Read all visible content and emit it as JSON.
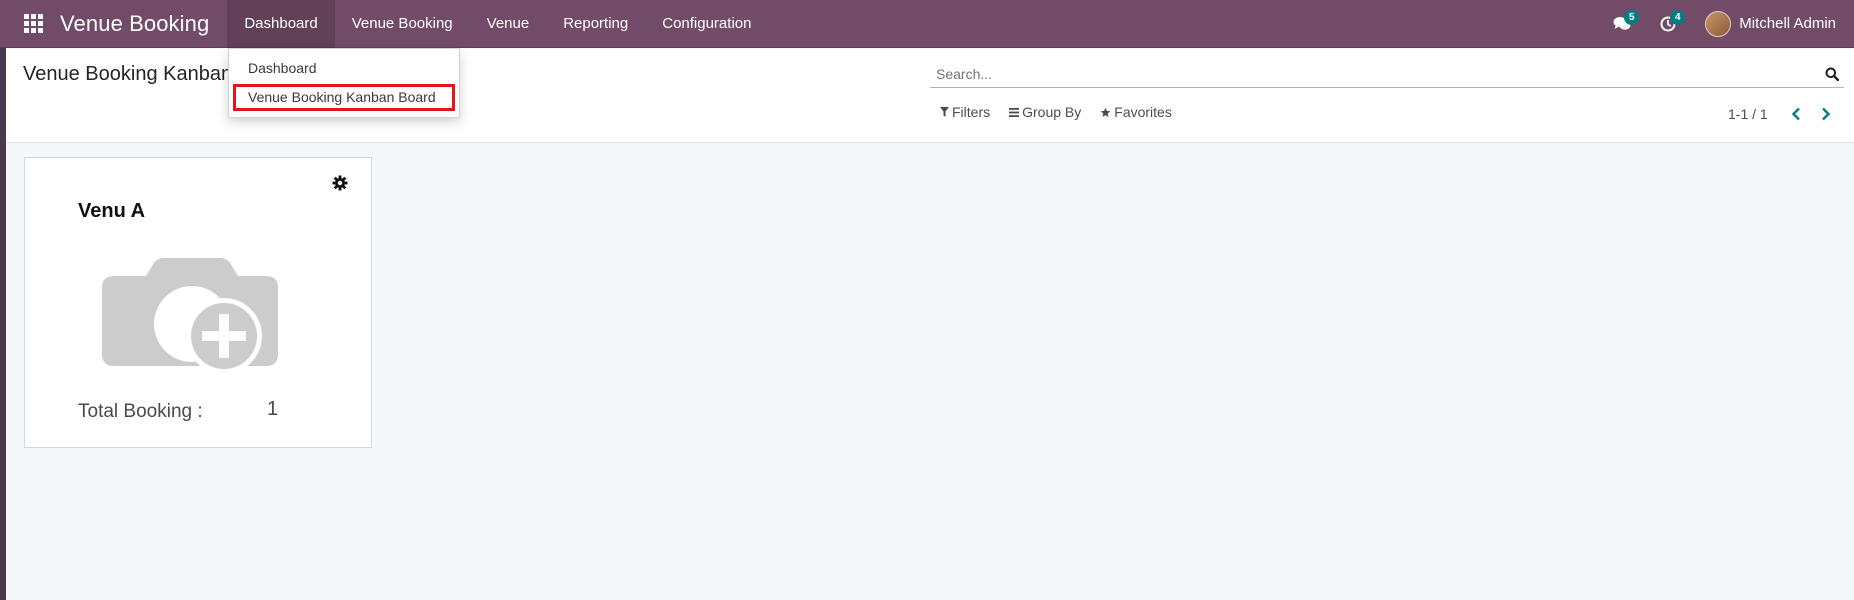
{
  "navbar": {
    "brand": "Venue Booking",
    "menu": [
      {
        "label": "Dashboard"
      },
      {
        "label": "Venue Booking"
      },
      {
        "label": "Venue"
      },
      {
        "label": "Reporting"
      },
      {
        "label": "Configuration"
      }
    ],
    "messages_badge": "5",
    "activities_badge": "4",
    "user_name": "Mitchell Admin",
    "accent_color": "#714b67"
  },
  "dropdown": {
    "items": [
      "Dashboard",
      "Venue Booking Kanban Board"
    ],
    "highlighted": "Venue Booking Kanban Board"
  },
  "control_panel": {
    "breadcrumb": "Venue Booking Kanban",
    "search_placeholder": "Search...",
    "filters_label": "Filters",
    "group_by_label": "Group By",
    "favorites_label": "Favorites",
    "pager": "1-1 / 1"
  },
  "kanban": {
    "cards": [
      {
        "title": "Venu A",
        "total_label": "Total Booking :",
        "total_value": "1"
      }
    ]
  }
}
